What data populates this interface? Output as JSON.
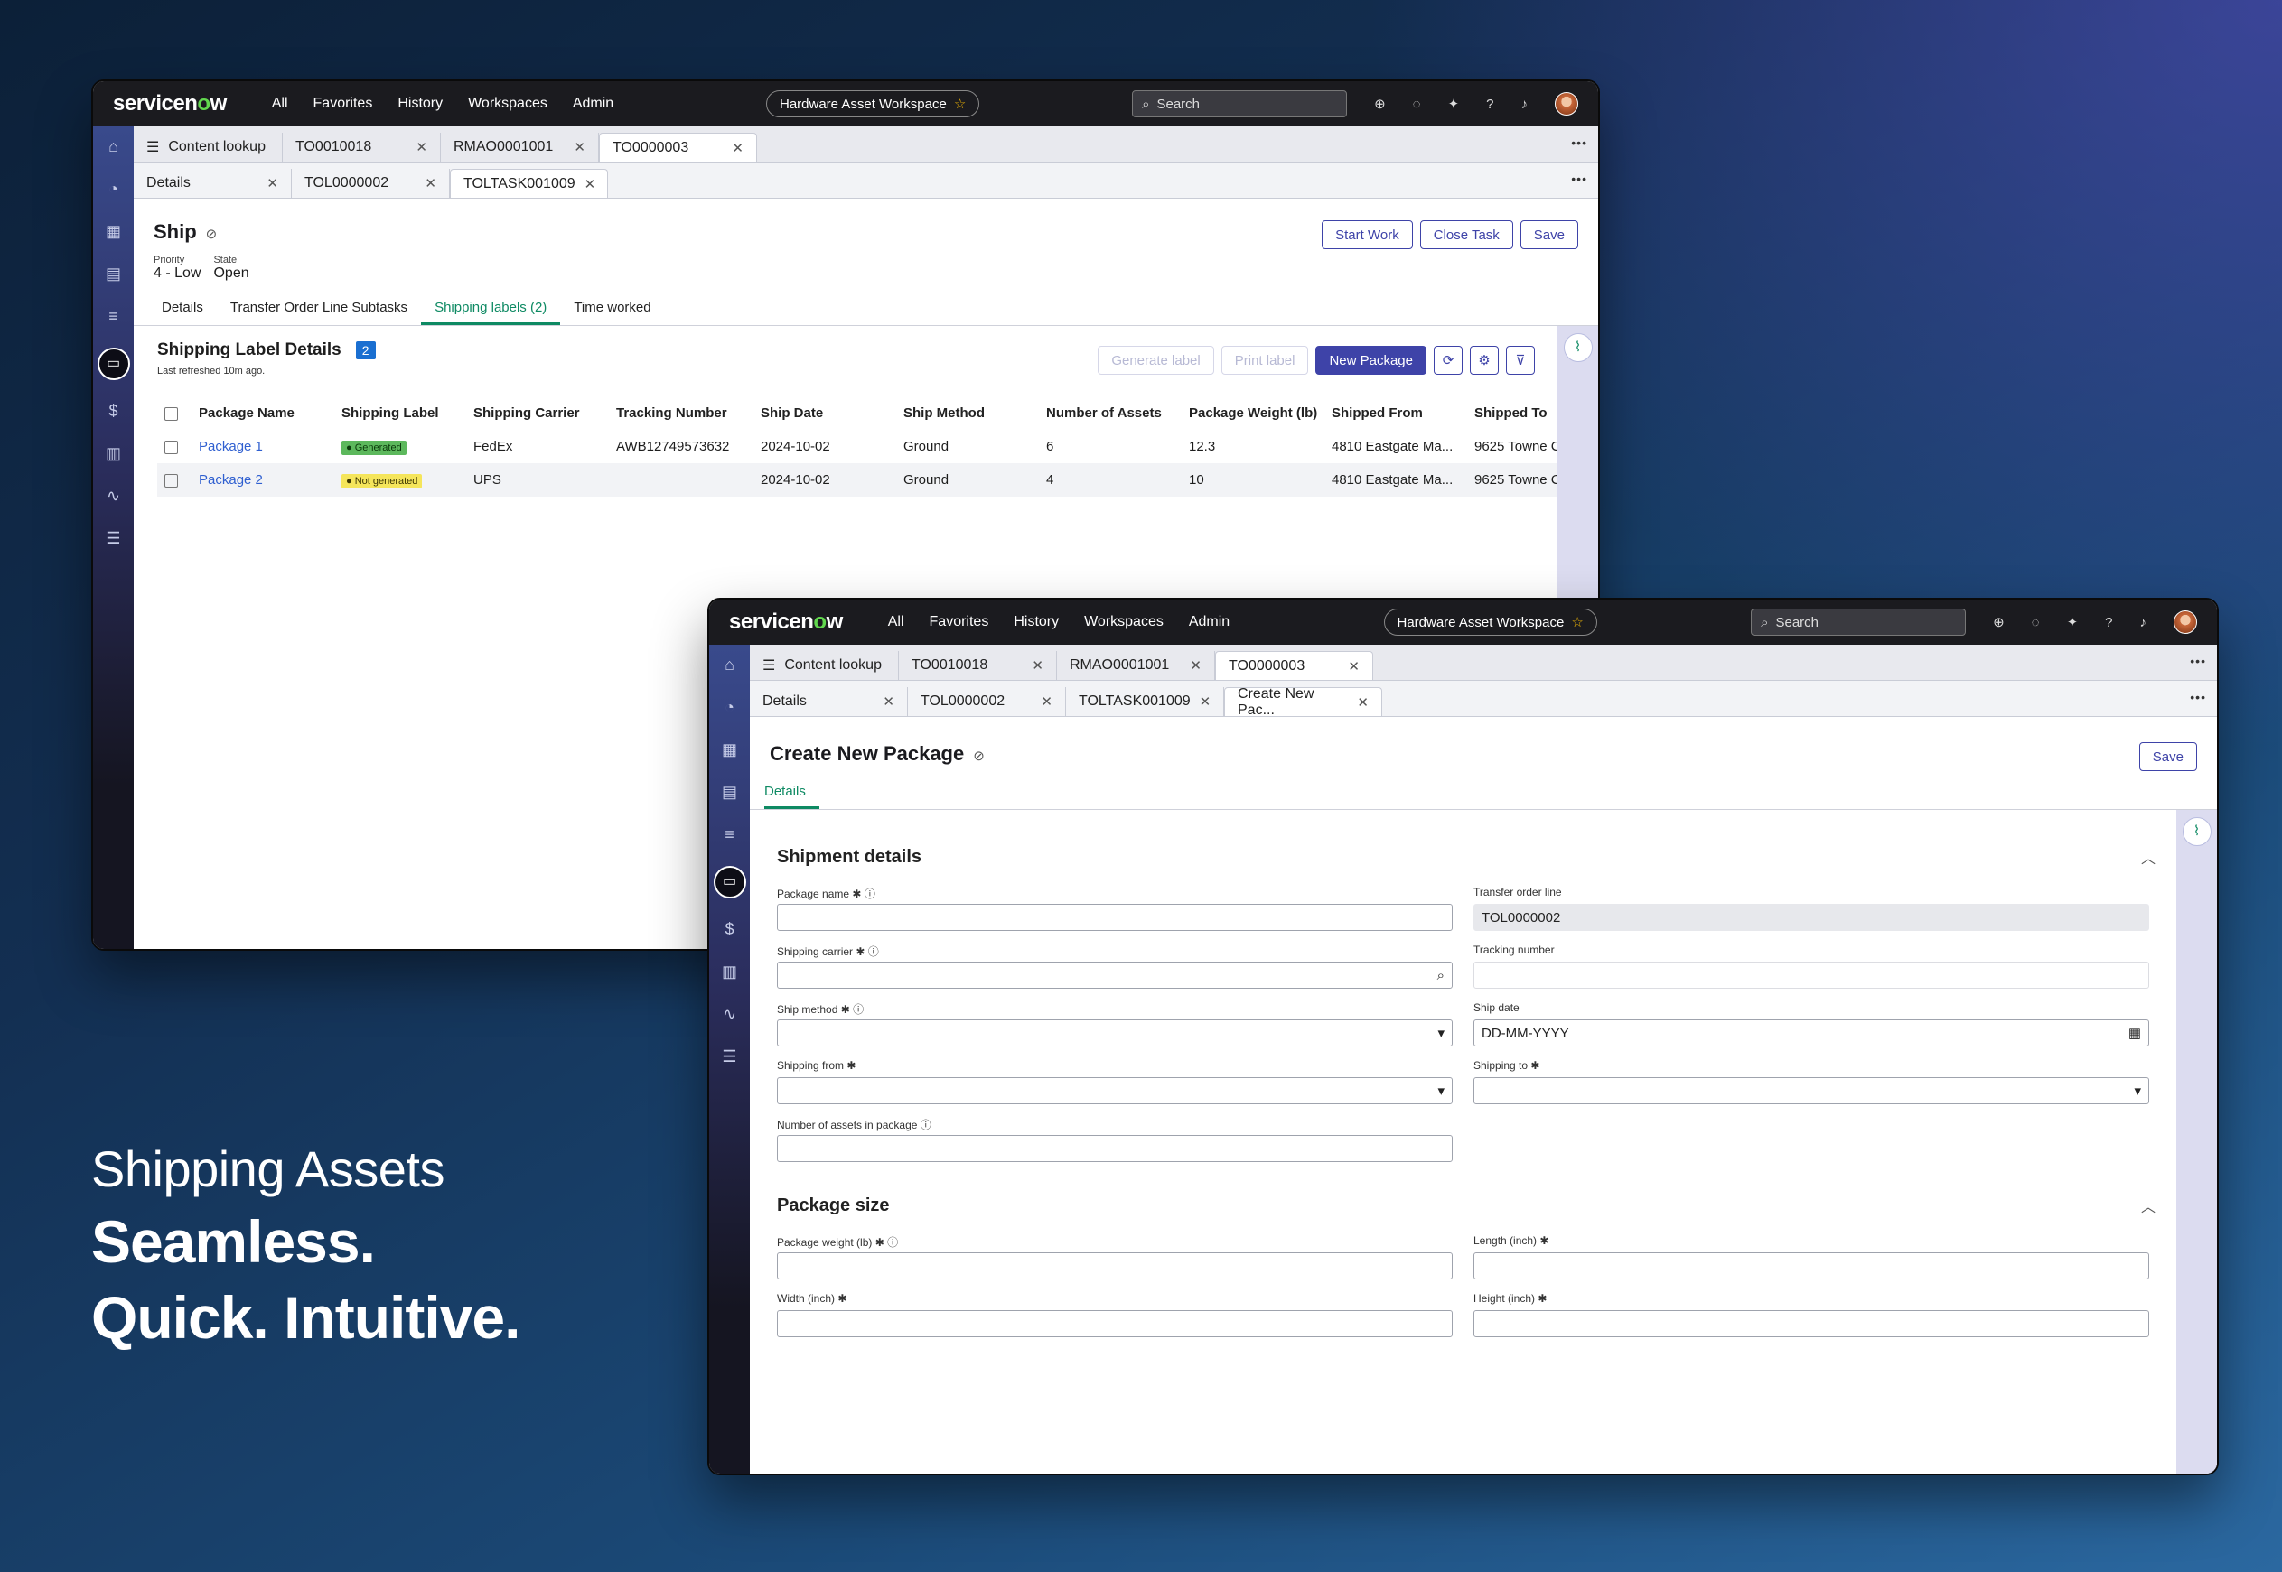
{
  "brand": {
    "logo_text": "servicen",
    "logo_accent": "o",
    "logo_tail": "w"
  },
  "nav": [
    "All",
    "Favorites",
    "History",
    "Workspaces",
    "Admin"
  ],
  "workspace_label": "Hardware Asset Workspace",
  "search_placeholder": "Search",
  "tabs1": [
    {
      "label": "Content lookup"
    },
    {
      "label": "TO0010018"
    },
    {
      "label": "RMAO0001001"
    },
    {
      "label": "TO0000003"
    }
  ],
  "w1": {
    "tabs2": [
      {
        "label": "Details"
      },
      {
        "label": "TOL0000002"
      },
      {
        "label": "TOLTASK001009"
      }
    ],
    "title": "Ship",
    "priority_label": "Priority",
    "priority_value": "4 - Low",
    "state_label": "State",
    "state_value": "Open",
    "buttons": {
      "start": "Start Work",
      "close": "Close Task",
      "save": "Save"
    },
    "form_tabs": [
      "Details",
      "Transfer Order Line Subtasks",
      "Shipping labels (2)",
      "Time worked"
    ],
    "section_title": "Shipping Label Details",
    "section_count": "2",
    "refreshed": "Last refreshed 10m ago.",
    "list_buttons": {
      "generate": "Generate label",
      "print": "Print label",
      "new": "New Package"
    },
    "columns": [
      "Package Name",
      "Shipping Label",
      "Shipping Carrier",
      "Tracking Number",
      "Ship Date",
      "Ship Method",
      "Number of Assets",
      "Package Weight (lb)",
      "Shipped From",
      "Shipped To"
    ],
    "rows": [
      {
        "name": "Package 1",
        "label": "Generated",
        "carrier": "FedEx",
        "tracking": "AWB12749573632",
        "date": "2024-10-02",
        "method": "Ground",
        "assets": "6",
        "weight": "12.3",
        "from": "4810 Eastgate Ma...",
        "to": "9625 Towne C"
      },
      {
        "name": "Package 2",
        "label": "Not generated",
        "carrier": "UPS",
        "tracking": "",
        "date": "2024-10-02",
        "method": "Ground",
        "assets": "4",
        "weight": "10",
        "from": "4810 Eastgate Ma...",
        "to": "9625 Towne C"
      }
    ]
  },
  "w2": {
    "tabs2": [
      {
        "label": "Details"
      },
      {
        "label": "TOL0000002"
      },
      {
        "label": "TOLTASK001009"
      },
      {
        "label": "Create New Pac..."
      }
    ],
    "title": "Create New Package",
    "save": "Save",
    "form_tab": "Details",
    "shipment_title": "Shipment details",
    "package_title": "Package size",
    "fields": {
      "package_name": "Package name",
      "transfer_order_line": "Transfer order line",
      "transfer_order_line_value": "TOL0000002",
      "shipping_carrier": "Shipping carrier",
      "tracking_number": "Tracking number",
      "ship_method": "Ship method",
      "ship_date": "Ship date",
      "ship_date_placeholder": "DD-MM-YYYY",
      "shipping_from": "Shipping from",
      "shipping_to": "Shipping to",
      "num_assets": "Number of assets in package",
      "package_weight": "Package weight (lb)",
      "length": "Length (inch)",
      "width": "Width (inch)",
      "height": "Height (inch)"
    }
  },
  "headline": {
    "sub": "Shipping Assets",
    "line1": "Seamless.",
    "line2": "Quick. Intuitive."
  }
}
